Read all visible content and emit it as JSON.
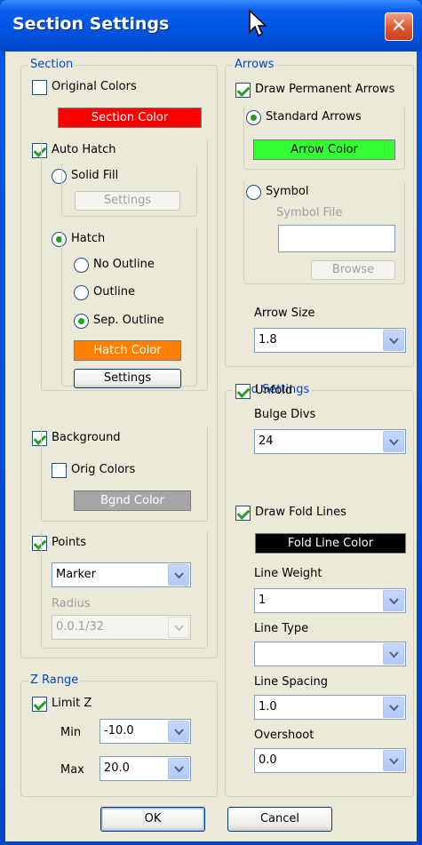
{
  "window": {
    "title": "Section Settings",
    "close_glyph": "✕"
  },
  "section": {
    "legend": "Section",
    "original_colors": {
      "label": "Original Colors",
      "checked": false
    },
    "section_color": {
      "label": "Section Color",
      "color": "#FF0000"
    },
    "auto_hatch": {
      "label": "Auto Hatch",
      "checked": true
    },
    "solid_fill": {
      "label": "Solid Fill",
      "selected": false,
      "settings_label": "Settings"
    },
    "hatch": {
      "label": "Hatch",
      "selected": true
    },
    "no_outline": {
      "label": "No Outline",
      "selected": false
    },
    "outline": {
      "label": "Outline",
      "selected": false
    },
    "sep_outline": {
      "label": "Sep. Outline",
      "selected": true
    },
    "hatch_color": {
      "label": "Hatch Color",
      "color": "#FF7F00"
    },
    "hatch_settings_label": "Settings",
    "background": {
      "label": "Background",
      "checked": true
    },
    "orig_colors": {
      "label": "Orig Colors",
      "checked": false
    },
    "bgnd_color": {
      "label": "Bgnd Color",
      "color": "#A6A6A6"
    },
    "points": {
      "label": "Points",
      "checked": true
    },
    "marker": {
      "value": "Marker"
    },
    "radius": {
      "label": "Radius",
      "value": "0.0.1/32"
    }
  },
  "zrange": {
    "legend": "Z Range",
    "limit_z": {
      "label": "Limit Z",
      "checked": true
    },
    "min": {
      "label": "Min",
      "value": "-10.0"
    },
    "max": {
      "label": "Max",
      "value": "20.0"
    }
  },
  "arrows": {
    "legend": "Arrows",
    "draw_permanent": {
      "label": "Draw Permanent Arrows",
      "checked": true
    },
    "standard": {
      "label": "Standard Arrows",
      "selected": true
    },
    "arrow_color": {
      "label": "Arrow Color",
      "color": "#33FF33"
    },
    "symbol": {
      "label": "Symbol",
      "selected": false
    },
    "symbol_file": {
      "label": "Symbol File",
      "value": ""
    },
    "browse_label": "Browse",
    "arrow_size": {
      "label": "Arrow Size",
      "value": "1.8"
    }
  },
  "fold": {
    "legend": "Fold Settings",
    "unfold": {
      "label": "Unfold",
      "checked": true
    },
    "bulge_divs": {
      "label": "Bulge Divs",
      "value": "24"
    },
    "draw_fold_lines": {
      "label": "Draw Fold Lines",
      "checked": true
    },
    "fold_line_color": {
      "label": "Fold Line Color",
      "color": "#000000"
    },
    "line_weight": {
      "label": "Line Weight",
      "value": "1"
    },
    "line_type": {
      "label": "Line Type",
      "value": ""
    },
    "line_spacing": {
      "label": "Line Spacing",
      "value": "1.0"
    },
    "overshoot": {
      "label": "Overshoot",
      "value": "0.0"
    }
  },
  "buttons": {
    "ok": "OK",
    "cancel": "Cancel"
  }
}
